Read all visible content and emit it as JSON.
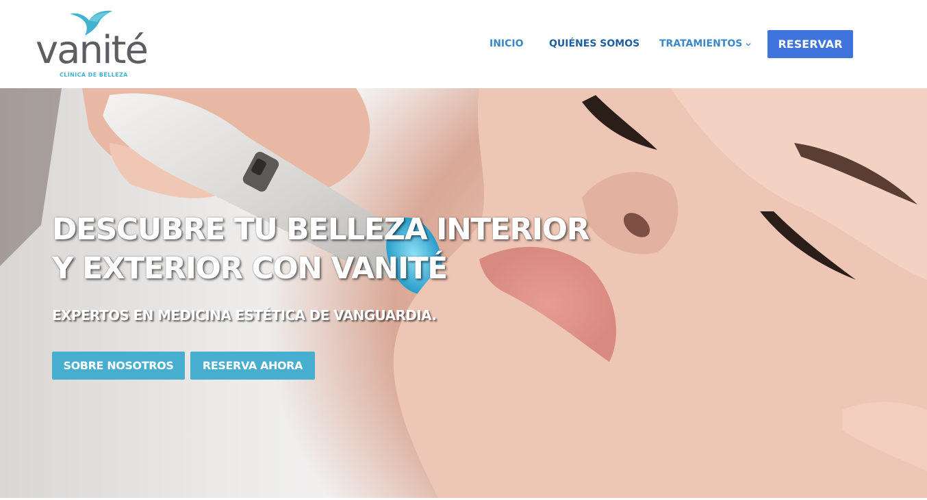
{
  "brand": {
    "name": "vanité",
    "tagline": "CLÍNICA DE BELLEZA",
    "logo_color": "#5d5e62",
    "accent_color": "#3fb3d0"
  },
  "nav": {
    "items": [
      {
        "label": "INICIO"
      },
      {
        "label": "QUIÉNES SOMOS"
      },
      {
        "label": "TRATAMIENTOS",
        "has_dropdown": true
      }
    ],
    "cta_label": "RESERVAR",
    "cta_color": "#3f74dd"
  },
  "hero": {
    "title_line1": "DESCUBRE TU BELLEZA INTERIOR",
    "title_line2": "Y EXTERIOR CON VANITÉ",
    "subtitle": "EXPERTOS EN MEDICINA ESTÉTICA DE VANGUARDIA.",
    "buttons": [
      {
        "label": "SOBRE NOSOTROS"
      },
      {
        "label": "RESERVA AHORA"
      }
    ],
    "button_color": "#47aed0"
  }
}
